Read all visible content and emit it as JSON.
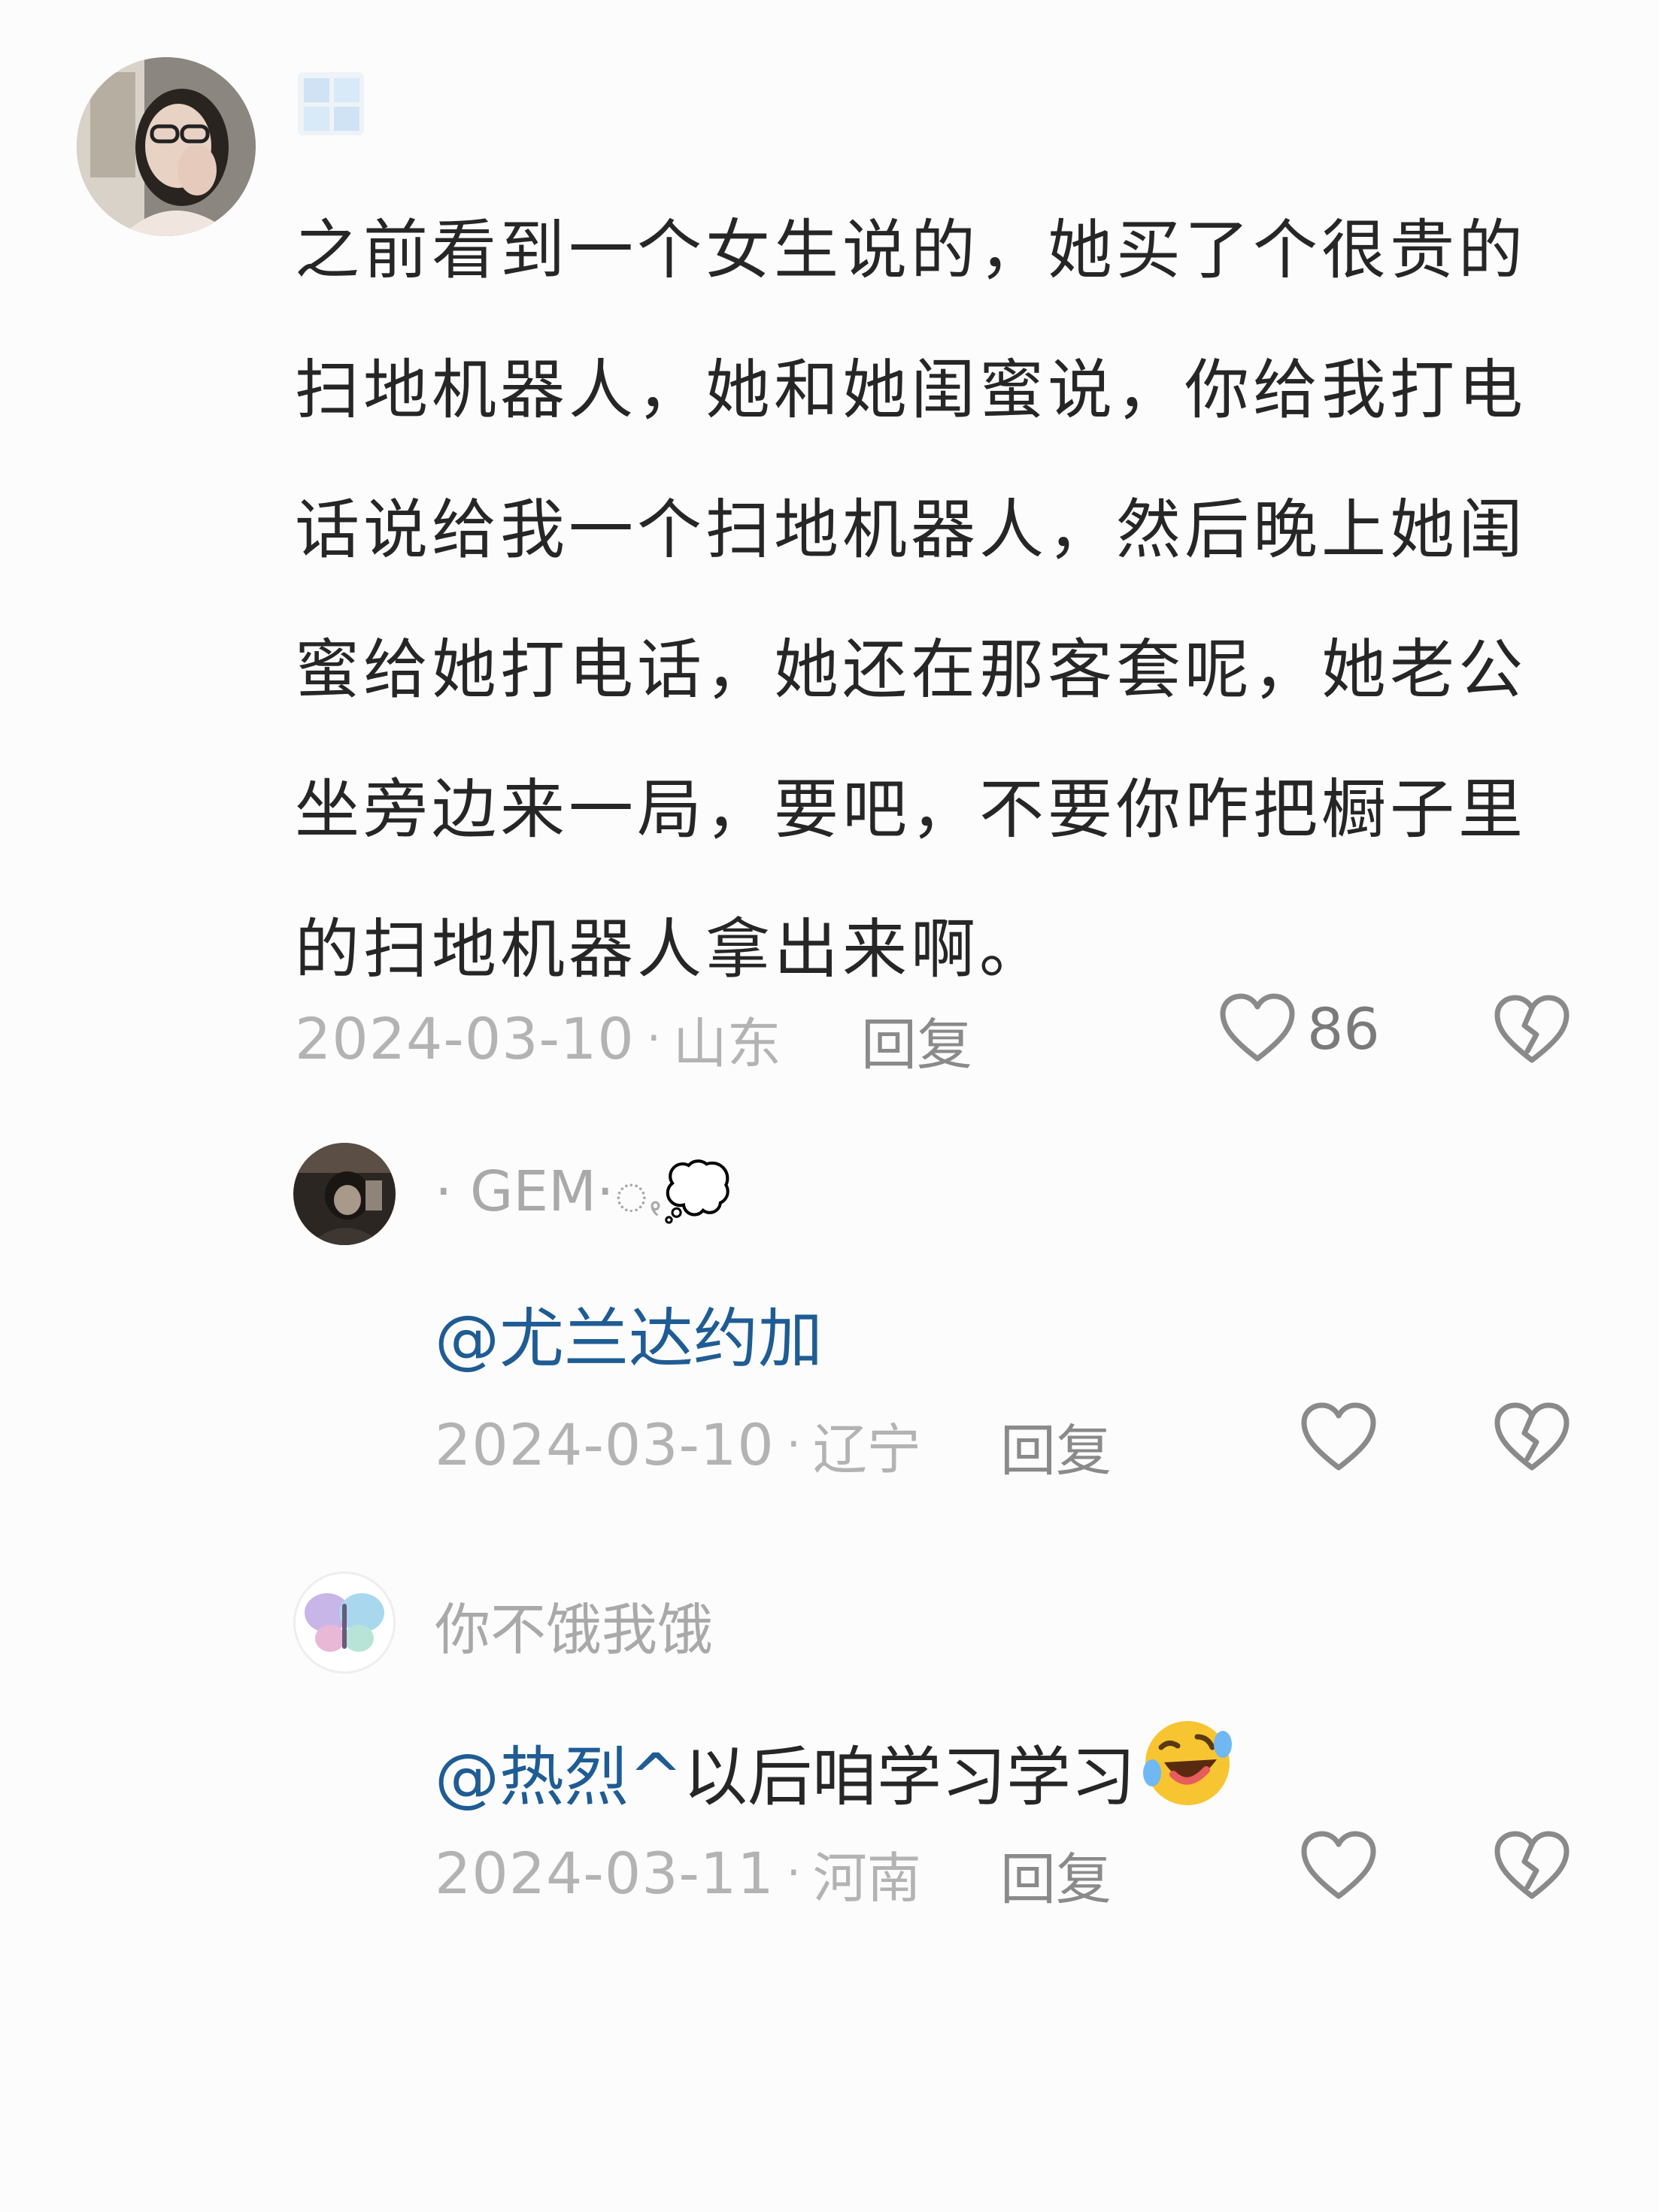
{
  "main_comment": {
    "text_lines": [
      "之前看到一个女生说的，她买了个很贵的",
      "扫地机器人，她和她闺蜜说，你给我打电",
      "话说给我一个扫地机器人，然后晚上她闺",
      "蜜给她打电话，她还在那客套呢，她老公",
      "坐旁边来一局，要吧，不要你咋把橱子里",
      "的扫地机器人拿出来啊。"
    ],
    "date": "2024-03-10",
    "separator": "·",
    "location": "山东",
    "reply_label": "回复",
    "like_count": "86",
    "avatar_icon": "user-photo-avatar",
    "badge_icon": "window-badge-icon"
  },
  "replies": [
    {
      "username": "· GEM·ꩻ💭",
      "mention": "@尤兰达约加",
      "text": "",
      "emoji": "",
      "date": "2024-03-10",
      "separator": "·",
      "location": "辽宁",
      "reply_label": "回复",
      "avatar_icon": "dark-photo-avatar"
    },
    {
      "username": "你不饿我饿",
      "mention": "@热烈^",
      "text": " 以后咱学习学习",
      "emoji": "rolling-laughing-emoji",
      "date": "2024-03-11",
      "separator": "·",
      "location": "河南",
      "reply_label": "回复",
      "avatar_icon": "butterfly-avatar"
    }
  ],
  "colors": {
    "background": "#fcfcfc",
    "text": "#262626",
    "meta": "#b3b3b3",
    "mention": "#1f5c94",
    "icon": "#8a8a8a"
  }
}
